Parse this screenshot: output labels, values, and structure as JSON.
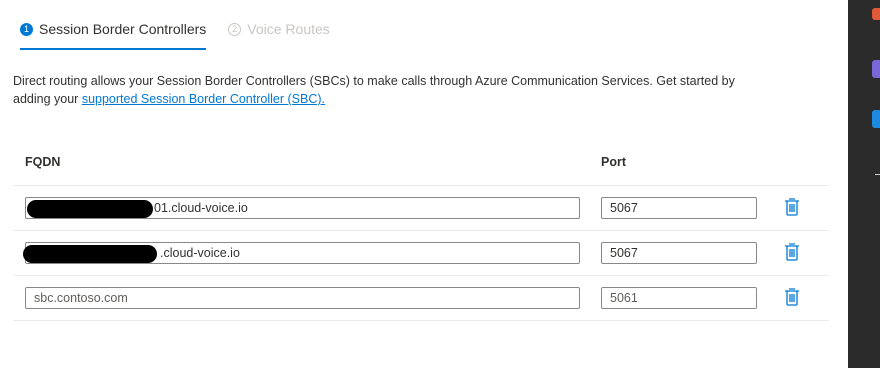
{
  "tabs": [
    {
      "number": "1",
      "label": "Session Border Controllers",
      "state": "active"
    },
    {
      "number": "2",
      "label": "Voice Routes",
      "state": "disabled"
    }
  ],
  "description": {
    "text": "Direct routing allows your Session Border Controllers (SBCs) to make calls through Azure Communication Services. Get started by adding your ",
    "link_text": "supported Session Border Controller (SBC)."
  },
  "table": {
    "columns": {
      "fqdn": "FQDN",
      "port": "Port"
    },
    "rows": [
      {
        "fqdn": "01.cloud-voice.io",
        "port": "5067",
        "redacted": true
      },
      {
        "fqdn": ".cloud-voice.io",
        "port": "5067",
        "redacted": true
      },
      {
        "fqdn": "",
        "fqdn_placeholder": "sbc.contoso.com",
        "port": "",
        "port_placeholder": "5061",
        "redacted": false
      }
    ]
  },
  "icons": {
    "delete": "trash-icon"
  },
  "colors": {
    "accent": "#0078d4",
    "disabled": "#c8c6c4",
    "side_rail": "#2b2b2b"
  }
}
